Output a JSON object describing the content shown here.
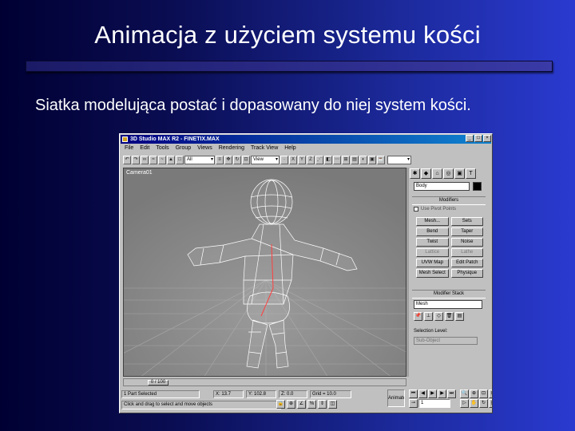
{
  "slide": {
    "title": "Animacja z użyciem systemu kości",
    "subtitle": "Siatka modelująca postać i dopasowany do niej system kości."
  },
  "window": {
    "title": "3D Studio MAX R2 - FINETIX.MAX",
    "menu": [
      "File",
      "Edit",
      "Tools",
      "Group",
      "Views",
      "Rendering",
      "Track View",
      "Help"
    ],
    "toolbar_select_all": "All",
    "toolbar_select_view": "View",
    "viewport_label": "Camera01",
    "time_slider": "0 / 100",
    "status": {
      "selection": "1 Part Selected",
      "x": "X: 13.7",
      "y": "Y: 102.8",
      "z": "Z: 0.0",
      "grid": "Grid = 10.0",
      "prompt": "Click and drag to select and move objects",
      "animate": "Animate",
      "frame": "1"
    }
  },
  "command_panel": {
    "object_name": "Body",
    "modifiers_title": "Modifiers",
    "use_pivot_points": "Use Pivot Points",
    "modifier_buttons": [
      "Mesh...",
      "Sets",
      "Bend",
      "Taper",
      "Twist",
      "Noise",
      "Lattice",
      "Lathe",
      "UVW Map",
      "Edit Patch",
      "Mesh Select",
      "Physique"
    ],
    "modifier_dim": [
      false,
      false,
      false,
      false,
      false,
      false,
      true,
      true,
      false,
      false,
      false,
      false
    ],
    "modifier_stack_title": "Modifier Stack",
    "stack_value": "Mesh",
    "selection_level_label": "Selection Level:",
    "selection_level_value": "Sub-Object"
  },
  "colors": {
    "mesh": "#ffffff",
    "viewport_bg": "#8c8c8c",
    "titlebar": "#000080"
  }
}
